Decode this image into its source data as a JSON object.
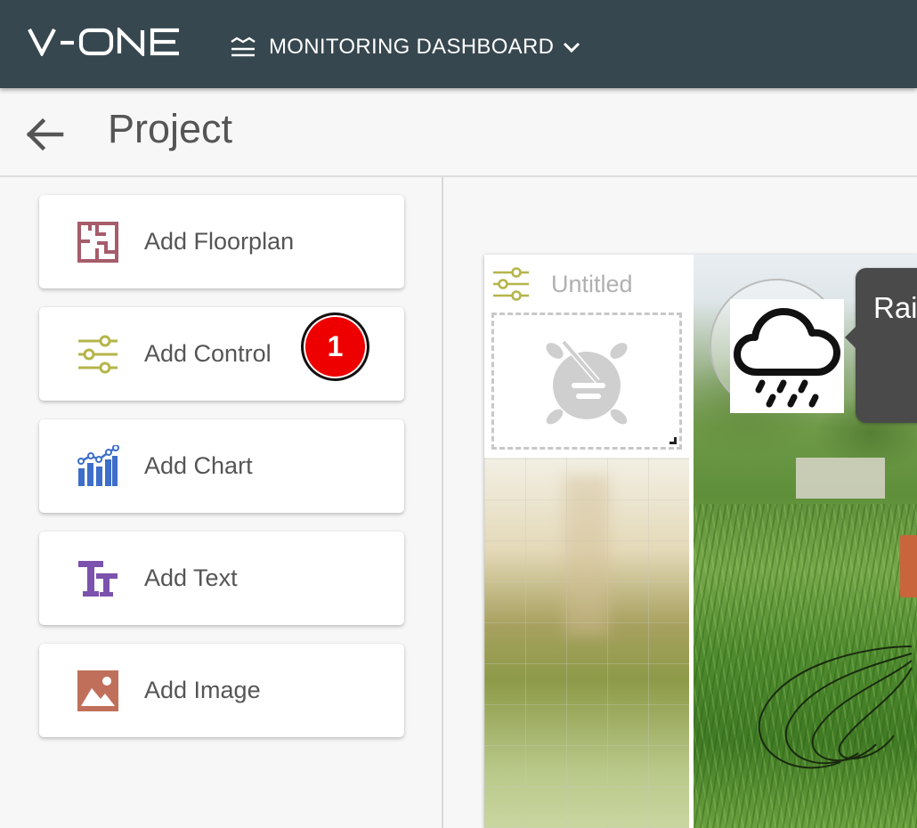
{
  "app": {
    "logo_text": "V-ONE",
    "dashboard_menu_label": "MONITORING DASHBOARD"
  },
  "page": {
    "title": "Project"
  },
  "widgets_panel": {
    "items": [
      {
        "label": "Add Floorplan",
        "icon": "floorplan-icon"
      },
      {
        "label": "Add Control",
        "icon": "sliders-icon"
      },
      {
        "label": "Add Chart",
        "icon": "bar-chart-icon"
      },
      {
        "label": "Add Text",
        "icon": "text-format-icon"
      },
      {
        "label": "Add Image",
        "icon": "image-icon"
      }
    ]
  },
  "annotation": {
    "step_badge": "1"
  },
  "canvas": {
    "control_widget": {
      "title": "Untitled",
      "icon": "sliders-icon",
      "placeholder_icon": "alarm-off-icon"
    },
    "weather_widget": {
      "icon": "rain-cloud-icon",
      "label": "Rai"
    }
  },
  "colors": {
    "topbar": "#37474f",
    "floorplan_icon": "#a65c6a",
    "control_icon": "#b5b54a",
    "chart_icon": "#3d6ec9",
    "text_icon": "#7b52ad",
    "image_icon": "#c0705a",
    "badge": "#ee0000"
  }
}
